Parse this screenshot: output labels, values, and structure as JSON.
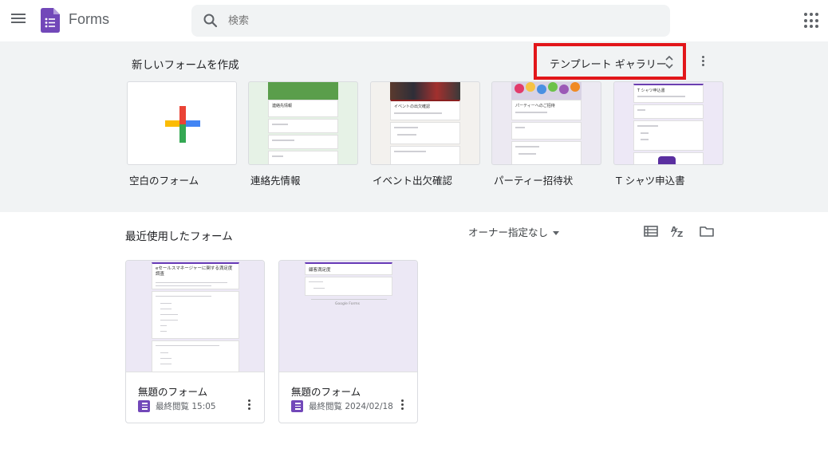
{
  "header": {
    "app_name": "Forms",
    "search_placeholder": "検索"
  },
  "templates": {
    "heading": "新しいフォームを作成",
    "gallery_label": "テンプレート ギャラリー",
    "items": [
      {
        "label": "空白のフォーム"
      },
      {
        "label": "連絡先情報"
      },
      {
        "label": "イベント出欠確認"
      },
      {
        "label": "パーティー招待状"
      },
      {
        "label": "T シャツ申込書"
      }
    ],
    "thumbnails": {
      "contact_title": "連絡先情報",
      "event_title": "イベントの出欠確認",
      "party_title": "パーティーへのご招待",
      "tshirt_title": "T シャツ申込書"
    }
  },
  "recent": {
    "heading": "最近使用したフォーム",
    "owner_filter": "オーナー指定なし",
    "forms": [
      {
        "title": "無題のフォーム",
        "meta": "最終閲覧 15:05",
        "preview_title": "eセールスマネージャーに関する満足度調査"
      },
      {
        "title": "無題のフォーム",
        "meta": "最終閲覧 2024/02/18",
        "preview_title": "顧客満足度",
        "preview_footer": "Google Forms"
      }
    ]
  },
  "colors": {
    "accent": "#673ab7",
    "highlight_box": "#e2161a",
    "band_background": "#f1f3f4"
  }
}
